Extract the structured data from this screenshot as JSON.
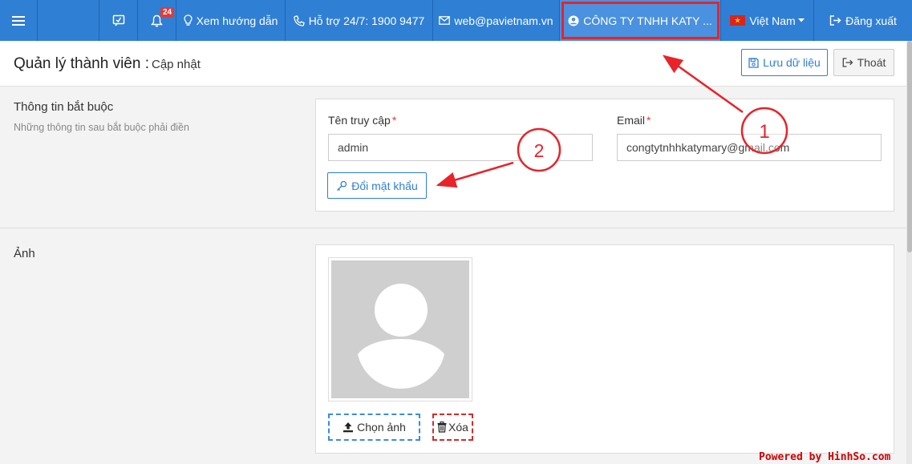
{
  "topbar": {
    "menu_icon": "hamburger-icon",
    "chat_icon": "message-check-icon",
    "bell_icon": "bell-icon",
    "notification_count": "24",
    "guide_label": "Xem hướng dẫn",
    "support_label": "Hỗ trợ 24/7: 1900 9477",
    "email_label": "web@pavietnam.vn",
    "company_label": "CÔNG TY TNHH KATY ...",
    "language_label": "Việt Nam",
    "logout_label": "Đăng xuất",
    "bar_color": "#2f7fd4"
  },
  "header": {
    "title": "Quản lý thành viên :",
    "subtitle": "Cập nhật",
    "save_label": "Lưu dữ liệu",
    "exit_label": "Thoát"
  },
  "required_section": {
    "title": "Thông tin bắt buộc",
    "description": "Những thông tin sau bắt buộc phải điền",
    "username_label": "Tên truy cập",
    "username_value": "admin",
    "email_label": "Email",
    "email_value": "congtytnhhkatymary@gmail.com",
    "change_password_label": "Đổi mật khẩu",
    "required_mark": "*"
  },
  "photo_section": {
    "title": "Ảnh",
    "choose_label": "Chọn ảnh",
    "delete_label": "Xóa"
  },
  "annotations": {
    "marker_1": "1",
    "marker_2": "2",
    "color": "#e8232a"
  },
  "watermark": "Powered by HinhSo.com"
}
